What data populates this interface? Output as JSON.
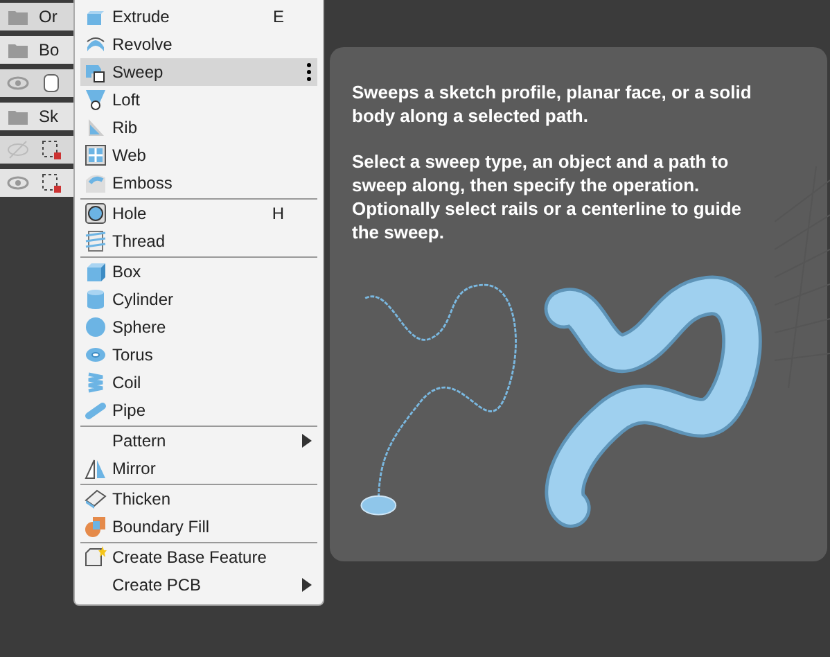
{
  "browser": {
    "rows": [
      {
        "kind": "folder",
        "label": "Or"
      },
      {
        "kind": "folder",
        "label": "Bo"
      },
      {
        "kind": "body",
        "visible": true
      },
      {
        "kind": "folder",
        "label": "Sk"
      },
      {
        "kind": "sketch",
        "visible": false
      },
      {
        "kind": "sketch",
        "visible": true
      }
    ]
  },
  "menu": {
    "groups": [
      [
        {
          "label": "Extrude",
          "shortcut": "E",
          "selected": false
        },
        {
          "label": "Revolve",
          "selected": false
        },
        {
          "label": "Sweep",
          "selected": true
        },
        {
          "label": "Loft",
          "selected": false
        },
        {
          "label": "Rib",
          "selected": false
        },
        {
          "label": "Web",
          "selected": false
        },
        {
          "label": "Emboss",
          "selected": false
        }
      ],
      [
        {
          "label": "Hole",
          "shortcut": "H",
          "selected": false
        },
        {
          "label": "Thread",
          "selected": false
        }
      ],
      [
        {
          "label": "Box",
          "selected": false
        },
        {
          "label": "Cylinder",
          "selected": false
        },
        {
          "label": "Sphere",
          "selected": false
        },
        {
          "label": "Torus",
          "selected": false
        },
        {
          "label": "Coil",
          "selected": false
        },
        {
          "label": "Pipe",
          "selected": false
        }
      ],
      [
        {
          "label": "Pattern",
          "submenu": true,
          "selected": false
        },
        {
          "label": "Mirror",
          "selected": false
        }
      ],
      [
        {
          "label": "Thicken",
          "selected": false
        },
        {
          "label": "Boundary Fill",
          "selected": false
        }
      ],
      [
        {
          "label": "Create Base Feature",
          "selected": false
        },
        {
          "label": "Create PCB",
          "submenu": true,
          "selected": false
        }
      ]
    ]
  },
  "tooltip": {
    "paragraphs": [
      "Sweeps a sketch profile, planar face, or a solid body along a selected path.",
      "Select a sweep type, an object and a path to sweep along, then specify the operation. Optionally select rails or a centerline to guide the sweep."
    ]
  }
}
